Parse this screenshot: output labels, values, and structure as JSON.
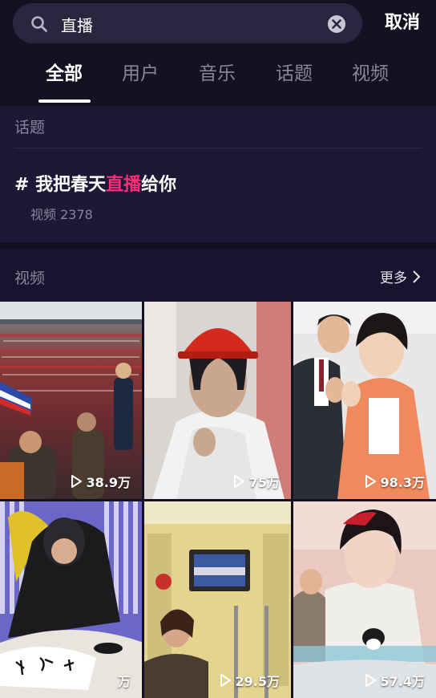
{
  "search": {
    "value": "直播",
    "cancel_label": "取消"
  },
  "tabs": [
    {
      "label": "全部",
      "active": true
    },
    {
      "label": "用户",
      "active": false
    },
    {
      "label": "音乐",
      "active": false
    },
    {
      "label": "话题",
      "active": false
    },
    {
      "label": "视频",
      "active": false
    }
  ],
  "topic_section": {
    "heading": "话题",
    "hash": "#",
    "title_before": "我把春天",
    "title_highlight": "直播",
    "title_after": "给你",
    "count_text": "视频 2378"
  },
  "video_section": {
    "heading": "视频",
    "more_label": "更多"
  },
  "videos": [
    {
      "plays": "38.9万"
    },
    {
      "plays": "75万"
    },
    {
      "plays": "98.3万"
    },
    {
      "plays": "万"
    },
    {
      "plays": "29.5万"
    },
    {
      "plays": "57.4万"
    }
  ],
  "colors": {
    "background": "#161023",
    "highlight": "#ff2e79",
    "muted_text": "#8a8598"
  },
  "icons": [
    "search-icon",
    "clear-icon",
    "chevron-right-icon",
    "play-icon"
  ]
}
